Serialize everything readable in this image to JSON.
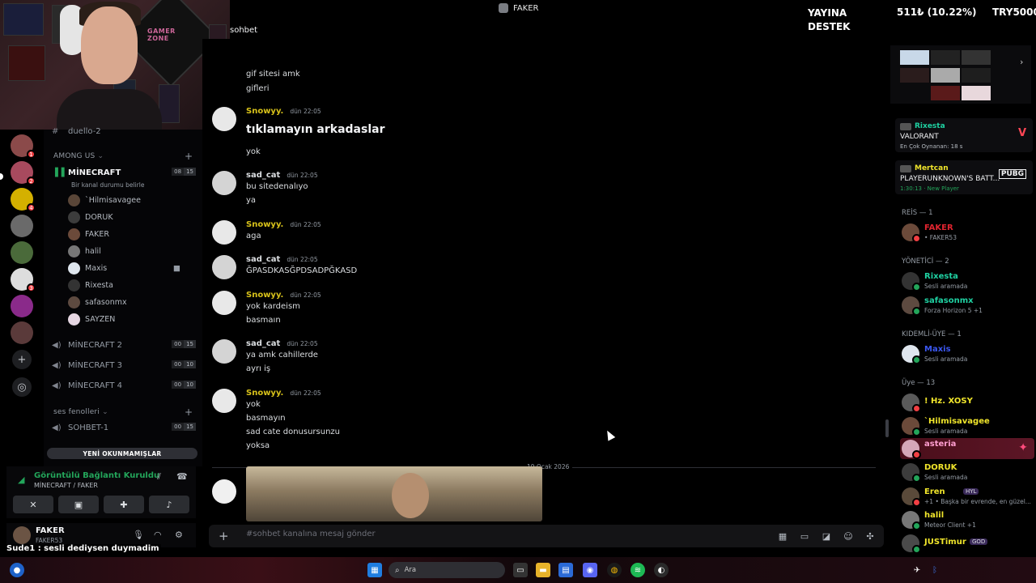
{
  "window": {
    "title": "FAKER"
  },
  "channel": {
    "name": "sohbet"
  },
  "overlay": {
    "left": "YAYINA DESTEK",
    "mid": "511₺ (10.22%)",
    "right": "TRY5000"
  },
  "servers": [
    {
      "badge": "1",
      "color": "#8b4a4a"
    },
    {
      "badge": "2",
      "color": "#a84a5e"
    },
    {
      "badge": "4",
      "color": "#d4b000"
    },
    {
      "badge": "",
      "color": "#6a6a6a"
    },
    {
      "badge": "",
      "color": "#4a6a3a"
    },
    {
      "badge": "3",
      "color": "#dddddd"
    },
    {
      "badge": "",
      "color": "#8a2a8a"
    },
    {
      "badge": "",
      "color": "#5a3a3a"
    }
  ],
  "sidebar": {
    "top_channel": "duello-2",
    "category_among": "AMONG US",
    "minecraft": {
      "name": "MİNECRAFT",
      "count_a": "08",
      "count_b": "15",
      "status": "Bir kanal durumu belirle"
    },
    "voice_users": [
      "`Hilmisavagee",
      "DORUK",
      "FAKER",
      "halil",
      "Maxis",
      "Rixesta",
      "safasonmx",
      "SAYZEN"
    ],
    "channels": [
      {
        "name": "MİNECRAFT 2",
        "a": "00",
        "b": "15"
      },
      {
        "name": "MİNECRAFT 3",
        "a": "00",
        "b": "10"
      },
      {
        "name": "MİNECRAFT 4",
        "a": "00",
        "b": "10"
      }
    ],
    "category_ses": "ses fenolleri",
    "sohbet1": {
      "name": "SOHBET-1",
      "a": "00",
      "b": "15"
    },
    "new_unreads": "YENİ OKUNMAMIŞLAR"
  },
  "voice_panel": {
    "status": "Görüntülü Bağlantı Kuruldu",
    "sub": "MİNECRAFT / FAKER"
  },
  "user_panel": {
    "name": "FAKER",
    "tag": "FAKER53"
  },
  "messages": {
    "m0_l1": "gif sitesi amk",
    "m0_l2": "gifleri",
    "m1_author": "Snowyy.",
    "m1_time": "dün 22:05",
    "m1_l1": "tıklamayın arkadaslar",
    "m1_l2": "yok",
    "m2_author": "sad_cat",
    "m2_time": "dün 22:05",
    "m2_l1": "bu sitedenalıyo",
    "m2_l2": "ya",
    "m3_author": "Snowyy.",
    "m3_time": "dün 22:05",
    "m3_l1": "aga",
    "m4_author": "sad_cat",
    "m4_time": "dün 22:05",
    "m4_l1": "ĞPASDKASĞPDSADPĞKASD",
    "m5_author": "Snowyy.",
    "m5_time": "dün 22:05",
    "m5_l1": "yok kardeism",
    "m5_l2": "basmaın",
    "m6_author": "sad_cat",
    "m6_time": "dün 22:05",
    "m6_l1": "ya amk cahillerde",
    "m6_l2": "ayrı iş",
    "m7_author": "Snowyy.",
    "m7_time": "dün 22:05",
    "m7_l1": "yok",
    "m7_l2": "basmayın",
    "m7_l3": "sad cate donusursunzu",
    "m7_l4": "yoksa",
    "date_divider": "19 Ocak 2026",
    "colors": {
      "snowyy": "#d8c21a",
      "sad_cat": "#dbdee1"
    }
  },
  "input": {
    "placeholder": "#sohbet kanalına mesaj gönder"
  },
  "members": {
    "activity1": {
      "name": "Rixesta",
      "game": "VALORANT",
      "sub": "En Çok Oynanan: 18 s"
    },
    "activity2": {
      "name": "Mertcan",
      "game": "PLAYERUNKNOWN'S BATT...",
      "sub": "1:30:13 · New Player"
    },
    "roles": [
      {
        "title": "REİS — 1",
        "members": [
          {
            "name": "FAKER",
            "status": "• FAKER53",
            "color": "#e0242f"
          }
        ]
      },
      {
        "title": "YÖNETİCİ — 2",
        "members": [
          {
            "name": "Rixesta",
            "status": "Sesli aramada",
            "color": "#1fd1a2"
          },
          {
            "name": "safasonmx",
            "status": "Forza Horizon 5 +1",
            "color": "#1fd1a2"
          }
        ]
      },
      {
        "title": "KIDEMLİ-ÜYE — 1",
        "members": [
          {
            "name": "Maxis",
            "status": "Sesli aramada",
            "color": "#3b57f0"
          }
        ]
      },
      {
        "title": "Üye — 13",
        "members": [
          {
            "name": "! Hz. XOSY",
            "status": "",
            "color": "#f0e52b"
          },
          {
            "name": "`Hilmisavagee",
            "status": "Sesli aramada",
            "color": "#f0e52b"
          },
          {
            "name": "asteria",
            "status": "",
            "color": "#ff9fd0"
          },
          {
            "name": "DORUK",
            "status": "Sesli aramada",
            "color": "#f0e52b"
          },
          {
            "name": "Eren",
            "status": "+1 • Başka bir evrende, en güzel...",
            "color": "#f0e52b"
          },
          {
            "name": "halil",
            "status": "Meteor Client +1",
            "color": "#f0e52b"
          },
          {
            "name": "JUSTimur",
            "status": "",
            "color": "#f0e52b"
          }
        ]
      }
    ],
    "eren_tag": "HYL",
    "justimur_tag": "GOD"
  },
  "subtitle": "Sude1 : sesli dediysen duymadim",
  "taskbar": {
    "search_placeholder": "Ara"
  }
}
